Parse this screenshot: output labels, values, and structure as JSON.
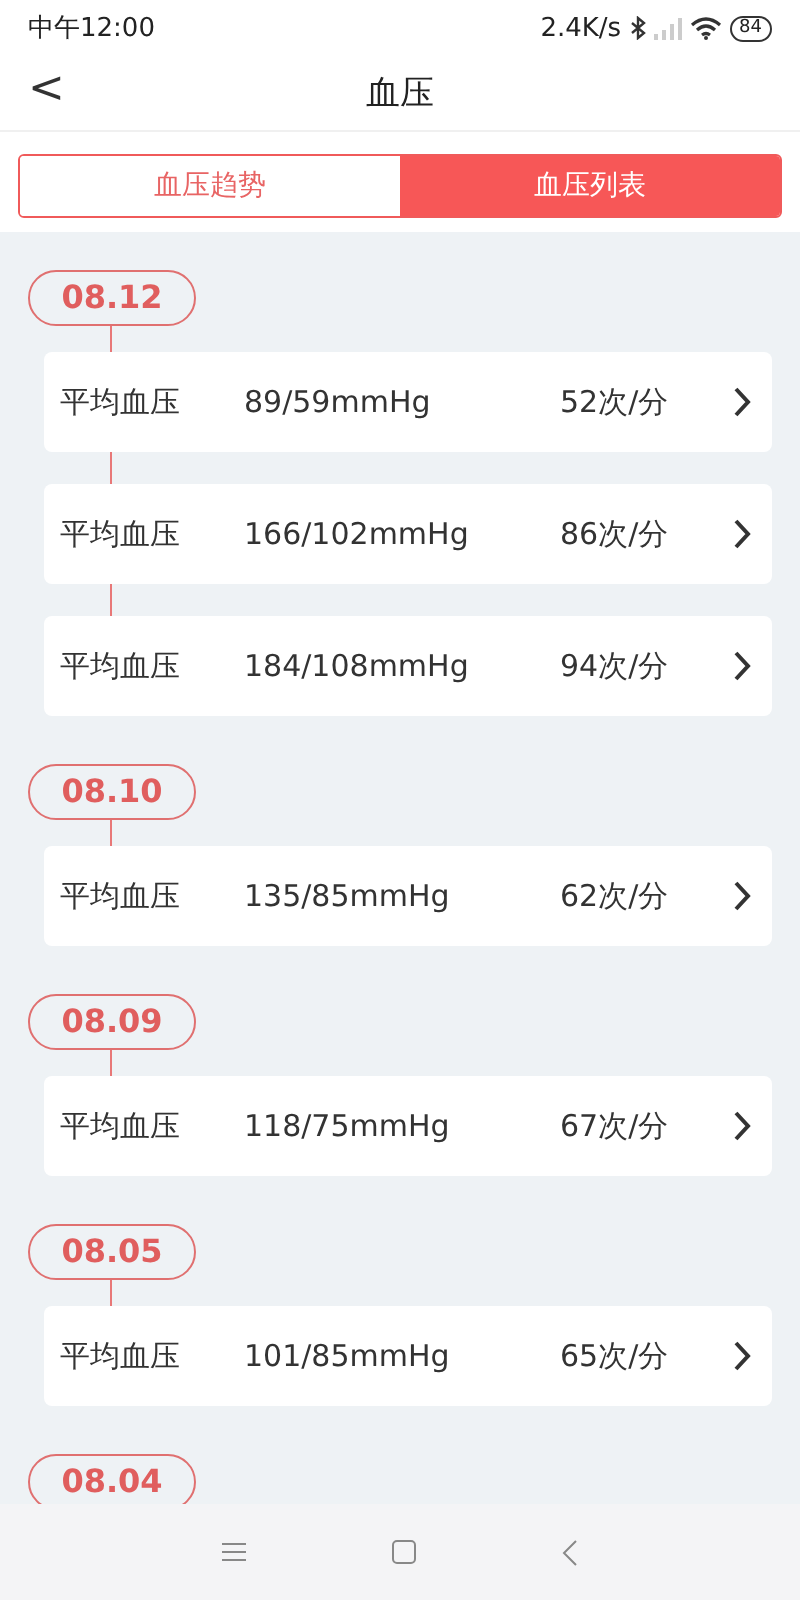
{
  "status_bar": {
    "time": "中午12:00",
    "speed": "2.4K/s",
    "battery": "84"
  },
  "header": {
    "back": "<",
    "title": "血压"
  },
  "tabs": [
    {
      "label": "血压趋势",
      "selected": false
    },
    {
      "label": "血压列表",
      "selected": true
    }
  ],
  "groups": [
    {
      "date": "08.12",
      "records": [
        {
          "label": "平均血压",
          "pressure": "89/59mmHg",
          "rate": "52次/分"
        },
        {
          "label": "平均血压",
          "pressure": "166/102mmHg",
          "rate": "86次/分"
        },
        {
          "label": "平均血压",
          "pressure": "184/108mmHg",
          "rate": "94次/分"
        }
      ]
    },
    {
      "date": "08.10",
      "records": [
        {
          "label": "平均血压",
          "pressure": "135/85mmHg",
          "rate": "62次/分"
        }
      ]
    },
    {
      "date": "08.09",
      "records": [
        {
          "label": "平均血压",
          "pressure": "118/75mmHg",
          "rate": "67次/分"
        }
      ]
    },
    {
      "date": "08.05",
      "records": [
        {
          "label": "平均血压",
          "pressure": "101/85mmHg",
          "rate": "65次/分"
        }
      ]
    },
    {
      "date": "08.04"
    }
  ]
}
